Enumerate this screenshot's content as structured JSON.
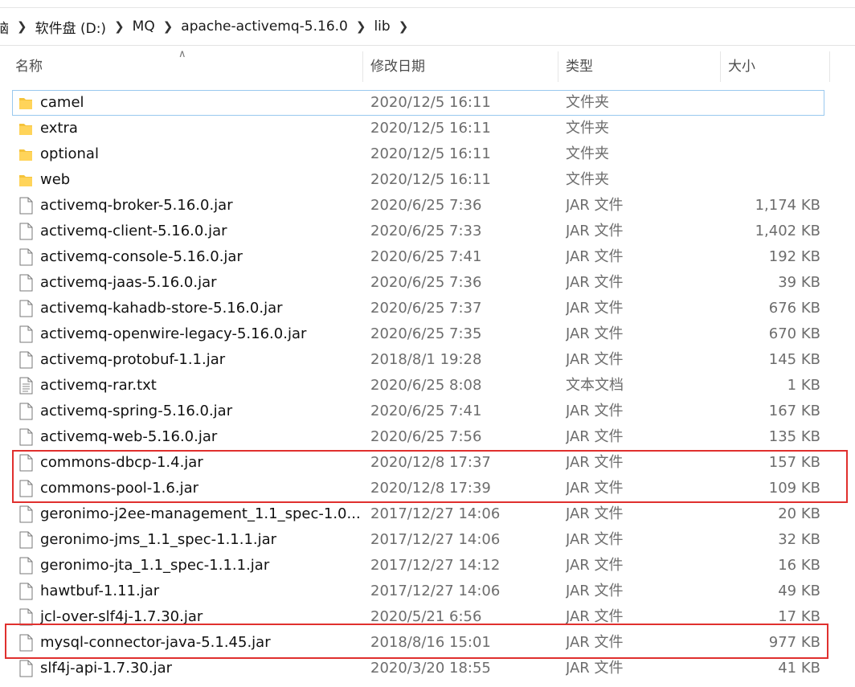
{
  "breadcrumb": [
    "脑",
    "软件盘 (D:)",
    "MQ",
    "apache-activemq-5.16.0",
    "lib"
  ],
  "columns": {
    "name": "名称",
    "date": "修改日期",
    "type": "类型",
    "size": "大小"
  },
  "files": [
    {
      "name": "camel",
      "date": "2020/12/5 16:11",
      "type": "文件夹",
      "size": "",
      "icon": "folder"
    },
    {
      "name": "extra",
      "date": "2020/12/5 16:11",
      "type": "文件夹",
      "size": "",
      "icon": "folder"
    },
    {
      "name": "optional",
      "date": "2020/12/5 16:11",
      "type": "文件夹",
      "size": "",
      "icon": "folder"
    },
    {
      "name": "web",
      "date": "2020/12/5 16:11",
      "type": "文件夹",
      "size": "",
      "icon": "folder"
    },
    {
      "name": "activemq-broker-5.16.0.jar",
      "date": "2020/6/25 7:36",
      "type": "JAR 文件",
      "size": "1,174 KB",
      "icon": "file"
    },
    {
      "name": "activemq-client-5.16.0.jar",
      "date": "2020/6/25 7:33",
      "type": "JAR 文件",
      "size": "1,402 KB",
      "icon": "file"
    },
    {
      "name": "activemq-console-5.16.0.jar",
      "date": "2020/6/25 7:41",
      "type": "JAR 文件",
      "size": "192 KB",
      "icon": "file"
    },
    {
      "name": "activemq-jaas-5.16.0.jar",
      "date": "2020/6/25 7:36",
      "type": "JAR 文件",
      "size": "39 KB",
      "icon": "file"
    },
    {
      "name": "activemq-kahadb-store-5.16.0.jar",
      "date": "2020/6/25 7:37",
      "type": "JAR 文件",
      "size": "676 KB",
      "icon": "file"
    },
    {
      "name": "activemq-openwire-legacy-5.16.0.jar",
      "date": "2020/6/25 7:35",
      "type": "JAR 文件",
      "size": "670 KB",
      "icon": "file"
    },
    {
      "name": "activemq-protobuf-1.1.jar",
      "date": "2018/8/1 19:28",
      "type": "JAR 文件",
      "size": "145 KB",
      "icon": "file"
    },
    {
      "name": "activemq-rar.txt",
      "date": "2020/6/25 8:08",
      "type": "文本文档",
      "size": "1 KB",
      "icon": "text-file"
    },
    {
      "name": "activemq-spring-5.16.0.jar",
      "date": "2020/6/25 7:41",
      "type": "JAR 文件",
      "size": "167 KB",
      "icon": "file"
    },
    {
      "name": "activemq-web-5.16.0.jar",
      "date": "2020/6/25 7:56",
      "type": "JAR 文件",
      "size": "135 KB",
      "icon": "file"
    },
    {
      "name": "commons-dbcp-1.4.jar",
      "date": "2020/12/8 17:37",
      "type": "JAR 文件",
      "size": "157 KB",
      "icon": "file"
    },
    {
      "name": "commons-pool-1.6.jar",
      "date": "2020/12/8 17:39",
      "type": "JAR 文件",
      "size": "109 KB",
      "icon": "file"
    },
    {
      "name": "geronimo-j2ee-management_1.1_spec-1.0....",
      "date": "2017/12/27 14:06",
      "type": "JAR 文件",
      "size": "20 KB",
      "icon": "file"
    },
    {
      "name": "geronimo-jms_1.1_spec-1.1.1.jar",
      "date": "2017/12/27 14:06",
      "type": "JAR 文件",
      "size": "32 KB",
      "icon": "file"
    },
    {
      "name": "geronimo-jta_1.1_spec-1.1.1.jar",
      "date": "2017/12/27 14:12",
      "type": "JAR 文件",
      "size": "16 KB",
      "icon": "file"
    },
    {
      "name": "hawtbuf-1.11.jar",
      "date": "2017/12/27 14:06",
      "type": "JAR 文件",
      "size": "49 KB",
      "icon": "file"
    },
    {
      "name": "jcl-over-slf4j-1.7.30.jar",
      "date": "2020/5/21 6:56",
      "type": "JAR 文件",
      "size": "17 KB",
      "icon": "file"
    },
    {
      "name": "mysql-connector-java-5.1.45.jar",
      "date": "2018/8/16 15:01",
      "type": "JAR 文件",
      "size": "977 KB",
      "icon": "file"
    },
    {
      "name": "slf4j-api-1.7.30.jar",
      "date": "2020/3/20 18:55",
      "type": "JAR 文件",
      "size": "41 KB",
      "icon": "file"
    }
  ],
  "colors": {
    "highlight": "#e0302e",
    "folder": "#f5c33b",
    "focus": "#99c9ef"
  }
}
